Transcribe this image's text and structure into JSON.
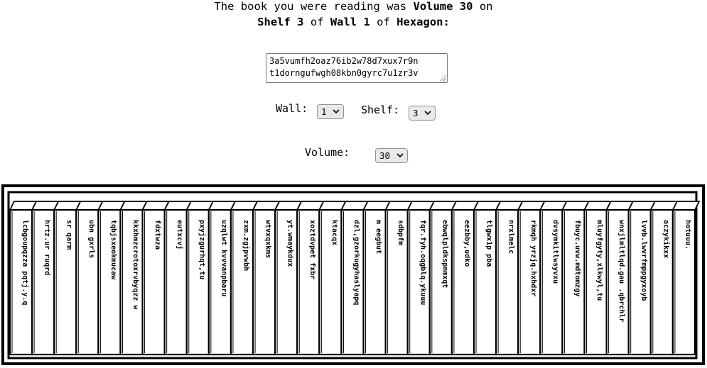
{
  "heading": {
    "line1_prefix": "The book you were reading was ",
    "volume_text": "Volume 30",
    "line1_suffix": " on",
    "shelf_text": "Shelf 3",
    "of1": " of ",
    "wall_text": "Wall 1",
    "of2": " of ",
    "hexagon_text": "Hexagon:"
  },
  "hexagon_address": {
    "line1": "3a5vumfh2oaz76ib2w78d7xux7r9n",
    "line2": "t1dorngufwgh08kbn0gyrc7u1zr3v"
  },
  "controls": {
    "wall_label": "Wall:",
    "wall_value": "1",
    "shelf_label": "Shelf:",
    "shelf_value": "3",
    "volume_label": "Volume:",
    "volume_value": "30"
  },
  "books": [
    "lcbgoupqzza pqtj.y.q",
    "hrtz.ur ruqrd",
    "sr qarm",
    "ubn gxrls",
    "tqbjsxeokmucaw",
    "kkxhmzcrotoxrvbyqzz w",
    "fdxtwza",
    "eutxcvj",
    "pxyjzgurhqt,tu",
    "uzqlwt kvvvanpbaru",
    "zxm.zgjpvwbh",
    "wtvxqxkms",
    "yt.wmaykdux",
    "xoztdvpet fxbr",
    "ktacqx",
    "dzl,gzorkugyhaslyapq",
    "m eegbut",
    "sdbpfm",
    "fqr.fyh.oqgblq.ykuuu",
    "ebwqlpldkspnmxqt",
    "eezbby,udko",
    "tlgwx1p pba",
    "nrxlmelc",
    "rkmqh yrzjq.hxhdxr",
    "dvsymkitlwsyvxu",
    "fbuyc.uvw.mdtomzgy",
    "mluyfgyty,xlkwyl,tu",
    "wnxjlmltlqd.gau .qbrchlr",
    "lvvb.lwvrfmppgyxoyb",
    "aczykikxx",
    "hotuuu."
  ]
}
